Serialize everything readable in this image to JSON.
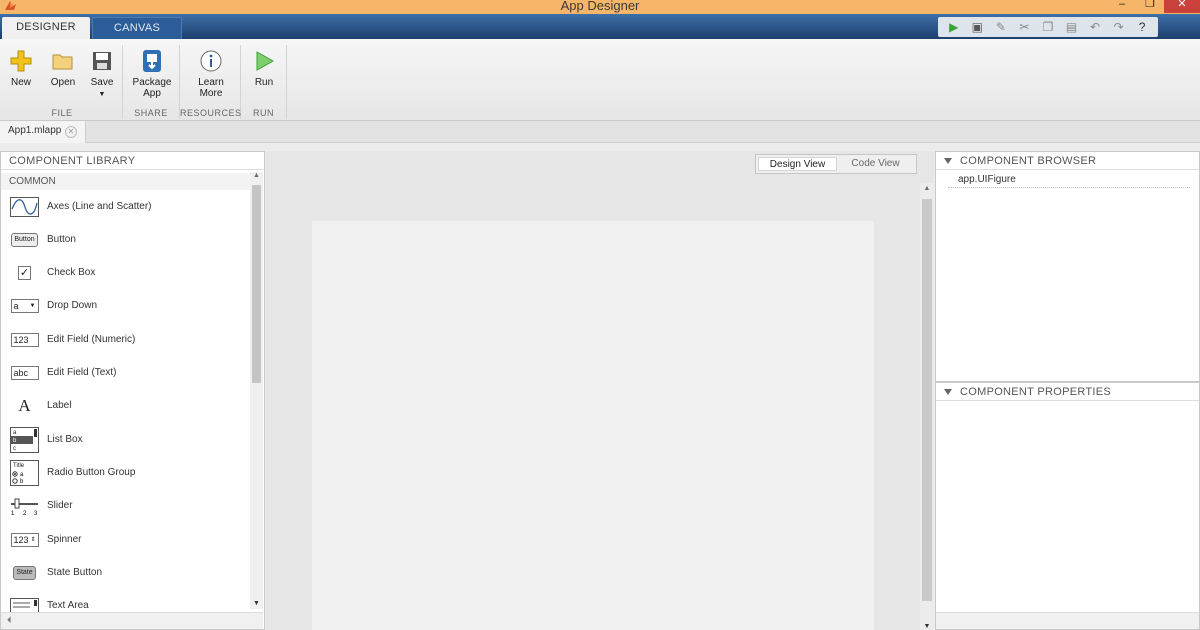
{
  "window": {
    "title": "App Designer",
    "minimize": "–",
    "maximize": "❐",
    "close": "✕"
  },
  "tabs": {
    "designer": "DESIGNER",
    "canvas": "CANVAS"
  },
  "ribbon": {
    "file": {
      "new": "New",
      "open": "Open",
      "save": "Save",
      "label": "FILE"
    },
    "share": {
      "package_line1": "Package",
      "package_line2": "App",
      "label": "SHARE"
    },
    "resources": {
      "learn_line1": "Learn",
      "learn_line2": "More",
      "label": "RESOURCES"
    },
    "run": {
      "run": "Run",
      "label": "RUN"
    }
  },
  "document": {
    "tab": "App1.mlapp"
  },
  "library": {
    "title": "COMPONENT LIBRARY",
    "section": "COMMON",
    "items": [
      {
        "label": "Axes (Line and Scatter)",
        "icon": "axes-icon"
      },
      {
        "label": "Button",
        "icon": "button-icon",
        "icon_text": "Button"
      },
      {
        "label": "Check Box",
        "icon": "check-box-icon"
      },
      {
        "label": "Drop Down",
        "icon": "drop-down-icon",
        "icon_text": "a"
      },
      {
        "label": "Edit Field (Numeric)",
        "icon": "edit-field-numeric-icon",
        "icon_text": "123"
      },
      {
        "label": "Edit Field (Text)",
        "icon": "edit-field-text-icon",
        "icon_text": "abc"
      },
      {
        "label": "Label",
        "icon": "label-icon",
        "icon_text": "A"
      },
      {
        "label": "List Box",
        "icon": "list-box-icon"
      },
      {
        "label": "Radio Button Group",
        "icon": "radio-button-group-icon",
        "icon_text": "Title"
      },
      {
        "label": "Slider",
        "icon": "slider-icon"
      },
      {
        "label": "Spinner",
        "icon": "spinner-icon",
        "icon_text": "123"
      },
      {
        "label": "State Button",
        "icon": "state-button-icon",
        "icon_text": "State"
      },
      {
        "label": "Text Area",
        "icon": "text-area-icon"
      }
    ]
  },
  "canvas": {
    "design_view": "Design View",
    "code_view": "Code View"
  },
  "browser": {
    "title": "COMPONENT BROWSER",
    "node": "app.UIFigure"
  },
  "properties": {
    "title": "COMPONENT PROPERTIES"
  },
  "colors": {
    "titlebar": "#f5b66a",
    "tabbar": "#1d3f6e",
    "run_green": "#3aa33a",
    "close_red": "#c9413a"
  }
}
